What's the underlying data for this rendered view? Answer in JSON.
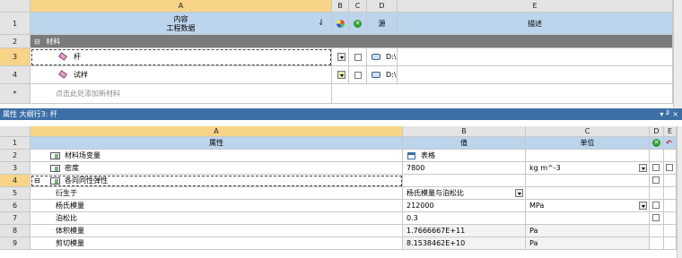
{
  "top": {
    "col_headers": [
      "A",
      "B",
      "C",
      "D",
      "E"
    ],
    "row_numbers": [
      "1",
      "2",
      "3",
      "4",
      "*"
    ],
    "header": {
      "title_line1": "内容",
      "title_line2": "工程数据",
      "source": "源",
      "description": "描述"
    },
    "section_label": "材料",
    "materials": [
      {
        "name": "杆",
        "source": "D:\\"
      },
      {
        "name": "试样",
        "source": "D:\\"
      }
    ],
    "add_placeholder": "点击此处添加新材料"
  },
  "panel": {
    "title": "属性 大纲行3: 杆",
    "pin": "▾ ╜ ×"
  },
  "bottom": {
    "col_headers": [
      "A",
      "B",
      "C",
      "D",
      "E"
    ],
    "row_numbers": [
      "1",
      "2",
      "3",
      "4",
      "5",
      "6",
      "7",
      "8",
      "9"
    ],
    "header": {
      "property": "属性",
      "value": "值",
      "unit": "单位"
    },
    "rows": [
      {
        "name": "材料场变量",
        "value": "表格",
        "unit": ""
      },
      {
        "name": "密度",
        "value": "7800",
        "unit": "kg m^-3"
      },
      {
        "name": "各向同性弹性",
        "value": "",
        "unit": ""
      },
      {
        "name": "衍生于",
        "value": "杨氏模量与泊松比",
        "unit": ""
      },
      {
        "name": "杨氏模量",
        "value": "212000",
        "unit": "MPa"
      },
      {
        "name": "泊松比",
        "value": "0.3",
        "unit": ""
      },
      {
        "name": "体积模量",
        "value": "1.7666667E+11",
        "unit": "Pa"
      },
      {
        "name": "剪切模量",
        "value": "8.1538462E+10",
        "unit": "Pa"
      }
    ]
  }
}
